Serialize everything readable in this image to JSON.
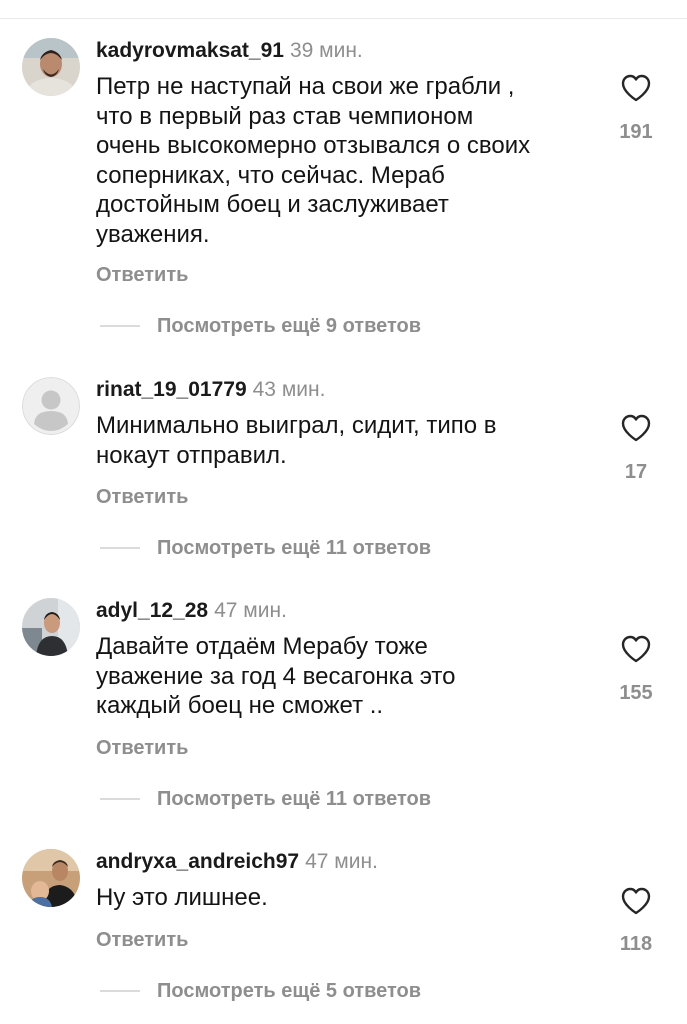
{
  "comments": [
    {
      "username": "kadyrovmaksat_91",
      "time": "39 мин.",
      "text": "Петр не наступай на свои же грабли ,\nчто в первый раз став чемпионом\nочень высокомерно отзывался о своих\nсоперниках, что сейчас. Мераб\nдостойным боец и заслуживает\nуважения.",
      "likes": "191",
      "reply_label": "Ответить",
      "view_replies": "Посмотреть ещё 9 ответов"
    },
    {
      "username": "rinat_19_01779",
      "time": "43 мин.",
      "text": "Минимально выиграл, сидит, типо в\nнокаут отправил.",
      "likes": "17",
      "reply_label": "Ответить",
      "view_replies": "Посмотреть ещё 11 ответов"
    },
    {
      "username": "adyl_12_28",
      "time": "47 мин.",
      "text": "Давайте отдаём Мерабу тоже\nуважение за год 4 весагонка это\nкаждый боец  не сможет ..",
      "likes": "155",
      "reply_label": "Ответить",
      "view_replies": "Посмотреть ещё 11 ответов"
    },
    {
      "username": "andryxa_andreich97",
      "time": "47 мин.",
      "text": "Ну это лишнее.",
      "likes": "118",
      "reply_label": "Ответить",
      "view_replies": "Посмотреть ещё 5 ответов"
    }
  ],
  "icons": {
    "like": "heart-outline-icon",
    "default_avatar": "person-silhouette-icon"
  },
  "colors": {
    "secondary_text": "#8e8e8e",
    "primary_text": "#141414",
    "divider": "#dbdbdb"
  }
}
